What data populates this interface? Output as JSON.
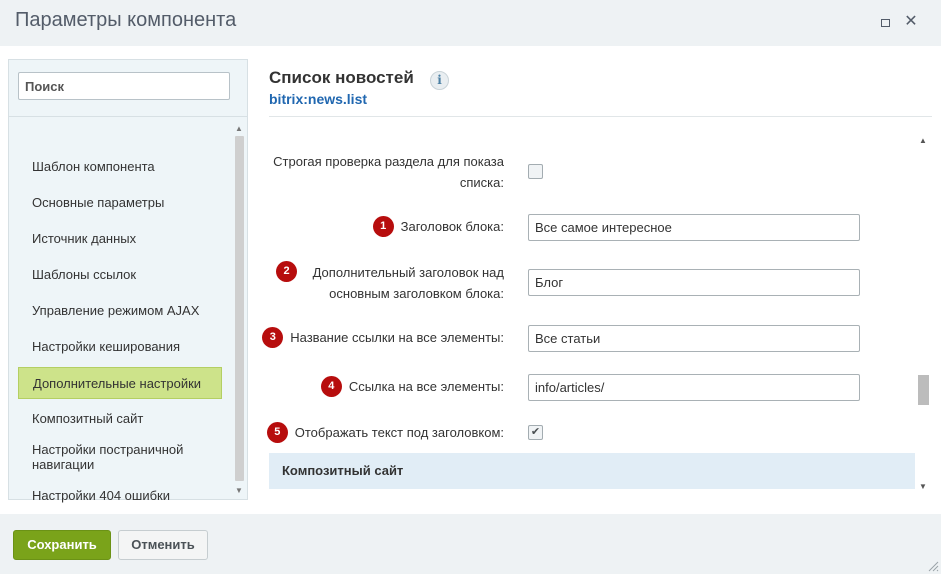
{
  "window": {
    "title": "Параметры компонента",
    "maximize_label": "",
    "close_label": "✕"
  },
  "sidebar": {
    "search_placeholder": "Поиск",
    "search_value": "",
    "items": [
      {
        "label": "Шаблон компонента"
      },
      {
        "label": "Основные параметры"
      },
      {
        "label": "Источник данных"
      },
      {
        "label": "Шаблоны ссылок"
      },
      {
        "label": "Управление режимом AJAX"
      },
      {
        "label": "Настройки кеширования"
      },
      {
        "label": "Дополнительные настройки",
        "active": true
      },
      {
        "label": "Композитный сайт"
      },
      {
        "label": "Настройки постраничной навигации"
      },
      {
        "label": "Настройки 404 ошибки"
      }
    ]
  },
  "main": {
    "title": "Список новостей",
    "info_icon": "i",
    "subtitle": "bitrix:news.list",
    "fields": [
      {
        "label": "Строгая проверка раздела для показа списка:",
        "type": "checkbox",
        "checked": false
      },
      {
        "badge": "1",
        "label": "Заголовок блока:",
        "type": "text",
        "value": "Все самое интересное"
      },
      {
        "badge": "2",
        "label": "Дополнительный заголовок над основным заголовком блока:",
        "type": "text",
        "value": "Блог"
      },
      {
        "badge": "3",
        "label": "Название ссылки на все элементы:",
        "type": "text",
        "value": "Все статьи"
      },
      {
        "badge": "4",
        "label": "Ссылка на все элементы:",
        "type": "text",
        "value": "info/articles/"
      },
      {
        "badge": "5",
        "label": "Отображать текст под заголовком:",
        "type": "checkbox",
        "checked": true
      }
    ],
    "section_header": "Композитный сайт"
  },
  "footer": {
    "save_label": "Сохранить",
    "cancel_label": "Отменить"
  },
  "colors": {
    "accent_green": "#7aa31a",
    "active_item": "#cde38a",
    "badge_red": "#b70d0d",
    "subtitle_blue": "#2067b0"
  }
}
